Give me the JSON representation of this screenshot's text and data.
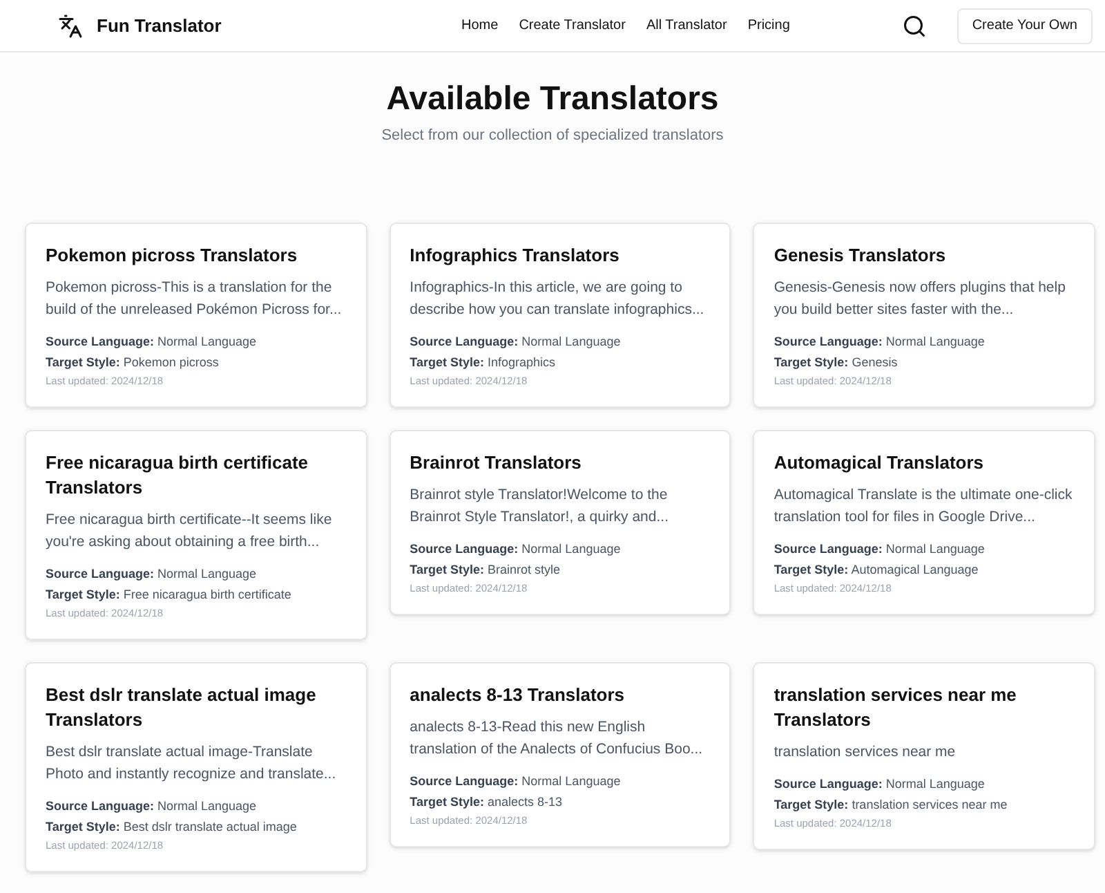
{
  "header": {
    "brand": "Fun Translator",
    "nav": [
      {
        "label": "Home"
      },
      {
        "label": "Create Translator"
      },
      {
        "label": "All Translator"
      },
      {
        "label": "Pricing"
      }
    ],
    "cta": "Create Your Own"
  },
  "hero": {
    "title": "Available Translators",
    "subtitle": "Select from our collection of specialized translators"
  },
  "cards": [
    {
      "title": "Pokemon picross Translators",
      "description": "Pokemon picross-This is a translation for the build of the unreleased Pokémon Picross for...",
      "source": "**Source Language:** Normal Language",
      "target": "**Target Style:** Pokemon picross",
      "updated": "Last updated: 2024/12/18"
    },
    {
      "title": "Infographics Translators",
      "description": "Infographics-In this article, we are going to describe how you can translate infographics...",
      "source": "**Source Language:** Normal Language",
      "target": "**Target Style:** Infographics",
      "updated": "Last updated: 2024/12/18"
    },
    {
      "title": "Genesis Translators",
      "description": "Genesis-Genesis now offers plugins that help you build better sites faster with the...",
      "source": "**Source Language:** Normal Language",
      "target": "**Target Style:** Genesis",
      "updated": "Last updated: 2024/12/18"
    },
    {
      "title": "Free nicaragua birth certificate Translators",
      "description": "Free nicaragua birth certificate--It seems like you're asking about obtaining a free birth...",
      "source": "**Source Language:** Normal Language",
      "target": "**Target Style:** Free nicaragua birth certificate",
      "updated": "Last updated: 2024/12/18"
    },
    {
      "title": "Brainrot Translators",
      "description": "Brainrot style Translator!Welcome to the Brainrot Style Translator!, a quirky and...",
      "source": "**Source Language:** Normal Language",
      "target": "**Target Style:** Brainrot style",
      "updated": "Last updated: 2024/12/18"
    },
    {
      "title": "Automagical Translators",
      "description": "Automagical Translate is the ultimate one-click translation tool for files in Google Drive...",
      "source": "**Source Language:** Normal Language",
      "target": "**Target Style:** Automagical Language",
      "updated": "Last updated: 2024/12/18"
    },
    {
      "title": "Best dslr translate actual image Translators",
      "description": "Best dslr translate actual image-Translate Photo and instantly recognize and translate...",
      "source": "**Source Language:** Normal Language",
      "target": "**Target Style:** Best dslr translate actual image",
      "updated": "Last updated: 2024/12/18"
    },
    {
      "title": "analects 8-13 Translators",
      "description": "analects 8-13-Read this new English translation of the Analects of Confucius Boo...",
      "source": "**Source Language:** Normal Language",
      "target": "**Target Style:** analects 8-13",
      "updated": "Last updated: 2024/12/18"
    },
    {
      "title": "translation services near me Translators",
      "description": "translation services near me",
      "source": "**Source Language:** Normal Language",
      "target": "**Target Style:** translation services near me",
      "updated": "Last updated: 2024/12/18"
    }
  ]
}
